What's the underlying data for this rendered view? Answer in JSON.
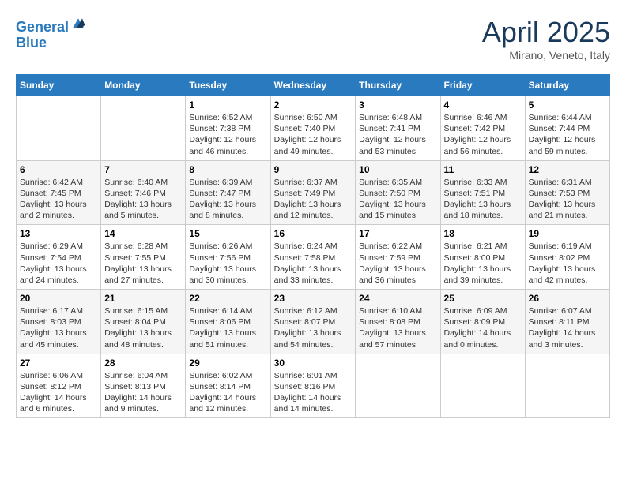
{
  "header": {
    "logo_line1": "General",
    "logo_line2": "Blue",
    "month": "April 2025",
    "location": "Mirano, Veneto, Italy"
  },
  "days_of_week": [
    "Sunday",
    "Monday",
    "Tuesday",
    "Wednesday",
    "Thursday",
    "Friday",
    "Saturday"
  ],
  "weeks": [
    [
      {
        "day": "",
        "text": ""
      },
      {
        "day": "",
        "text": ""
      },
      {
        "day": "1",
        "text": "Sunrise: 6:52 AM\nSunset: 7:38 PM\nDaylight: 12 hours and 46 minutes."
      },
      {
        "day": "2",
        "text": "Sunrise: 6:50 AM\nSunset: 7:40 PM\nDaylight: 12 hours and 49 minutes."
      },
      {
        "day": "3",
        "text": "Sunrise: 6:48 AM\nSunset: 7:41 PM\nDaylight: 12 hours and 53 minutes."
      },
      {
        "day": "4",
        "text": "Sunrise: 6:46 AM\nSunset: 7:42 PM\nDaylight: 12 hours and 56 minutes."
      },
      {
        "day": "5",
        "text": "Sunrise: 6:44 AM\nSunset: 7:44 PM\nDaylight: 12 hours and 59 minutes."
      }
    ],
    [
      {
        "day": "6",
        "text": "Sunrise: 6:42 AM\nSunset: 7:45 PM\nDaylight: 13 hours and 2 minutes."
      },
      {
        "day": "7",
        "text": "Sunrise: 6:40 AM\nSunset: 7:46 PM\nDaylight: 13 hours and 5 minutes."
      },
      {
        "day": "8",
        "text": "Sunrise: 6:39 AM\nSunset: 7:47 PM\nDaylight: 13 hours and 8 minutes."
      },
      {
        "day": "9",
        "text": "Sunrise: 6:37 AM\nSunset: 7:49 PM\nDaylight: 13 hours and 12 minutes."
      },
      {
        "day": "10",
        "text": "Sunrise: 6:35 AM\nSunset: 7:50 PM\nDaylight: 13 hours and 15 minutes."
      },
      {
        "day": "11",
        "text": "Sunrise: 6:33 AM\nSunset: 7:51 PM\nDaylight: 13 hours and 18 minutes."
      },
      {
        "day": "12",
        "text": "Sunrise: 6:31 AM\nSunset: 7:53 PM\nDaylight: 13 hours and 21 minutes."
      }
    ],
    [
      {
        "day": "13",
        "text": "Sunrise: 6:29 AM\nSunset: 7:54 PM\nDaylight: 13 hours and 24 minutes."
      },
      {
        "day": "14",
        "text": "Sunrise: 6:28 AM\nSunset: 7:55 PM\nDaylight: 13 hours and 27 minutes."
      },
      {
        "day": "15",
        "text": "Sunrise: 6:26 AM\nSunset: 7:56 PM\nDaylight: 13 hours and 30 minutes."
      },
      {
        "day": "16",
        "text": "Sunrise: 6:24 AM\nSunset: 7:58 PM\nDaylight: 13 hours and 33 minutes."
      },
      {
        "day": "17",
        "text": "Sunrise: 6:22 AM\nSunset: 7:59 PM\nDaylight: 13 hours and 36 minutes."
      },
      {
        "day": "18",
        "text": "Sunrise: 6:21 AM\nSunset: 8:00 PM\nDaylight: 13 hours and 39 minutes."
      },
      {
        "day": "19",
        "text": "Sunrise: 6:19 AM\nSunset: 8:02 PM\nDaylight: 13 hours and 42 minutes."
      }
    ],
    [
      {
        "day": "20",
        "text": "Sunrise: 6:17 AM\nSunset: 8:03 PM\nDaylight: 13 hours and 45 minutes."
      },
      {
        "day": "21",
        "text": "Sunrise: 6:15 AM\nSunset: 8:04 PM\nDaylight: 13 hours and 48 minutes."
      },
      {
        "day": "22",
        "text": "Sunrise: 6:14 AM\nSunset: 8:06 PM\nDaylight: 13 hours and 51 minutes."
      },
      {
        "day": "23",
        "text": "Sunrise: 6:12 AM\nSunset: 8:07 PM\nDaylight: 13 hours and 54 minutes."
      },
      {
        "day": "24",
        "text": "Sunrise: 6:10 AM\nSunset: 8:08 PM\nDaylight: 13 hours and 57 minutes."
      },
      {
        "day": "25",
        "text": "Sunrise: 6:09 AM\nSunset: 8:09 PM\nDaylight: 14 hours and 0 minutes."
      },
      {
        "day": "26",
        "text": "Sunrise: 6:07 AM\nSunset: 8:11 PM\nDaylight: 14 hours and 3 minutes."
      }
    ],
    [
      {
        "day": "27",
        "text": "Sunrise: 6:06 AM\nSunset: 8:12 PM\nDaylight: 14 hours and 6 minutes."
      },
      {
        "day": "28",
        "text": "Sunrise: 6:04 AM\nSunset: 8:13 PM\nDaylight: 14 hours and 9 minutes."
      },
      {
        "day": "29",
        "text": "Sunrise: 6:02 AM\nSunset: 8:14 PM\nDaylight: 14 hours and 12 minutes."
      },
      {
        "day": "30",
        "text": "Sunrise: 6:01 AM\nSunset: 8:16 PM\nDaylight: 14 hours and 14 minutes."
      },
      {
        "day": "",
        "text": ""
      },
      {
        "day": "",
        "text": ""
      },
      {
        "day": "",
        "text": ""
      }
    ]
  ]
}
